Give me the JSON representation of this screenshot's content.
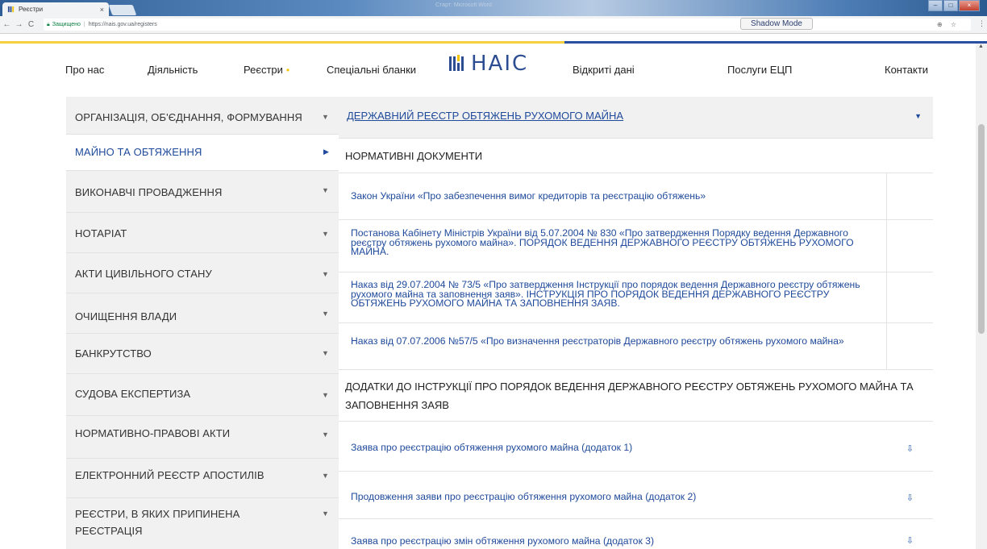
{
  "browser": {
    "tab_title": "Реєстри",
    "tab_close": "×",
    "window_title": "Старт: Microsoft Word",
    "secure_label": "Защищено",
    "url": "https://nais.gov.ua/registers",
    "shadow_mode": "Shadow Mode",
    "nav_back": "←",
    "nav_forward": "→",
    "nav_reload": "C",
    "page_icons": "⊕ ☆",
    "kebab": "⋮"
  },
  "nav": {
    "about": "Про нас",
    "activity": "Діяльність",
    "registers": "Реєстри",
    "special_forms": "Спеціальні бланки",
    "logo": "НАІС",
    "open_data": "Відкриті дані",
    "eds_services": "Послуги ЕЦП",
    "contacts": "Контакти"
  },
  "sidebar": {
    "items": [
      {
        "label": "Організація, об'єднання, формування"
      },
      {
        "label": "Майно та обтяження"
      },
      {
        "label": "Виконавчі провадження"
      },
      {
        "label": "Нотаріат"
      },
      {
        "label": "Акти цивільного стану"
      },
      {
        "label": "Очищення влади"
      },
      {
        "label": "Банкрутство"
      },
      {
        "label": "Судова експертиза"
      },
      {
        "label": "Нормативно-правові акти"
      },
      {
        "label": "Електронний реєстр апостилів"
      },
      {
        "label": "Реєстри, в яких припинена реєстрація"
      }
    ]
  },
  "main": {
    "register_title": "Державний реєстр обтяжень рухомого майна",
    "section_normative": "Нормативні документи",
    "docs": [
      {
        "text": "Закон України «Про забезпечення вимог кредиторів та реєстрацію обтяжень»"
      },
      {
        "text": "Постанова Кабінету Міністрів України від 5.07.2004 № 830 «Про затвердження Порядку ведення Державного реєстру обтяжень рухомого майна». ПОРЯДОК ВЕДЕННЯ ДЕРЖАВНОГО РЕЄСТРУ ОБТЯЖЕНЬ РУХОМОГО МАЙНА."
      },
      {
        "text": "Наказ від 29.07.2004 № 73/5 «Про затвердження Інструкції про порядок ведення Державного реєстру обтяжень рухомого майна та заповнення заяв». ІНСТРУКЦІЯ ПРО ПОРЯДОК ВЕДЕННЯ ДЕРЖАВНОГО РЕЄСТРУ ОБТЯЖЕНЬ РУХОМОГО МАЙНА ТА ЗАПОВНЕННЯ ЗАЯВ."
      },
      {
        "text": "Наказ від 07.07.2006 №57/5 «Про визначення реєстраторів Державного реєстру обтяжень рухомого майна»"
      }
    ],
    "section_appendix": "Додатки до інструкції про порядок ведення державного реєстру обтяжень рухомого майна та заповнення заяв",
    "attachments": [
      {
        "text": "Заява про реєстрацію обтяження рухомого майна (додаток 1)"
      },
      {
        "text": "Продовження заяви про реєстрацію обтяження рухомого майна (додаток 2)"
      },
      {
        "text": "Заява про реєстрацію змін обтяження рухомого майна (додаток 3)"
      }
    ]
  },
  "colors": {
    "accent_blue": "#1f4a9b",
    "accent_yellow": "#f5d142",
    "sidebar_bg": "#f1f1f1"
  }
}
